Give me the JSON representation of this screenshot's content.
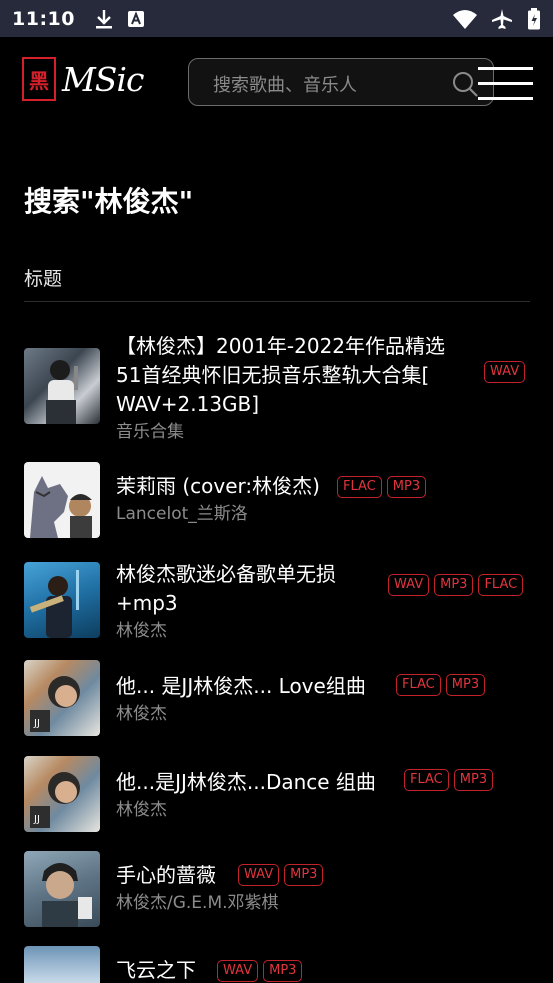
{
  "status": {
    "time": "11:10"
  },
  "header": {
    "logo_seal": "黑",
    "logo_text": "MSic",
    "search_placeholder": "搜索歌曲、音乐人"
  },
  "page": {
    "title": "搜索\"林俊杰\"",
    "section_label": "标题"
  },
  "results": [
    {
      "title_lines": [
        "【林俊杰】2001年-2022年作品精选",
        "51首经典怀旧无损音乐整轨大合集[",
        "WAV+2.13GB]"
      ],
      "subtitle": "音乐合集",
      "badges": [
        "WAV"
      ]
    },
    {
      "title_lines": [
        "茉莉雨 (cover:林俊杰)"
      ],
      "subtitle": "Lancelot_兰斯洛",
      "badges": [
        "FLAC",
        "MP3"
      ]
    },
    {
      "title_lines": [
        "林俊杰歌迷必备歌单无损",
        "+mp3"
      ],
      "subtitle": "林俊杰",
      "badges": [
        "WAV",
        "MP3",
        "FLAC"
      ]
    },
    {
      "title_lines": [
        "他... 是JJ林俊杰... Love组曲"
      ],
      "subtitle": "林俊杰",
      "badges": [
        "FLAC",
        "MP3"
      ]
    },
    {
      "title_lines": [
        "他...是JJ林俊杰...Dance 组曲"
      ],
      "subtitle": "林俊杰",
      "badges": [
        "FLAC",
        "MP3"
      ]
    },
    {
      "title_lines": [
        "手心的蔷薇"
      ],
      "subtitle": "林俊杰/G.E.M.邓紫棋",
      "badges": [
        "WAV",
        "MP3"
      ]
    },
    {
      "title_lines": [
        "飞云之下"
      ],
      "subtitle": "",
      "badges": [
        "WAV",
        "MP3"
      ]
    }
  ],
  "colors": {
    "badge_red": "#c2222a",
    "statusbar": "#262a3a"
  }
}
